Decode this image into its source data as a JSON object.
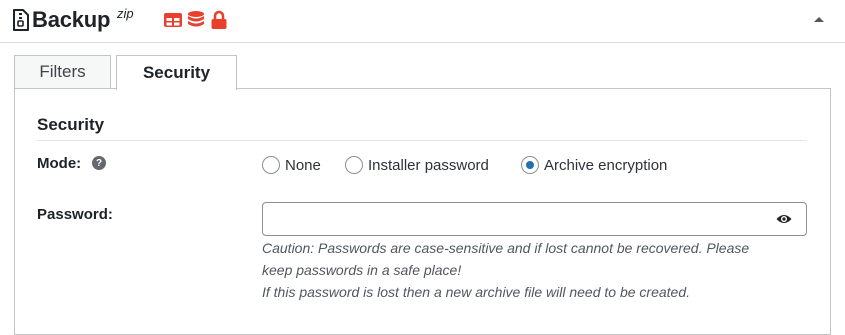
{
  "header": {
    "title": "Backup",
    "title_sup": "zip",
    "icons": [
      "file-zip-icon",
      "table-icon",
      "database-icon",
      "lock-icon",
      "collapse-arrow-icon"
    ],
    "accent_color": "#e8402d"
  },
  "tabs": [
    {
      "label": "Filters",
      "active": false
    },
    {
      "label": "Security",
      "active": true
    }
  ],
  "security": {
    "section_title": "Security",
    "mode": {
      "label": "Mode:",
      "help_icon": "question-icon",
      "options": [
        {
          "label": "None",
          "checked": false
        },
        {
          "label": "Installer password",
          "checked": false
        },
        {
          "label": "Archive encryption",
          "checked": true
        }
      ]
    },
    "password": {
      "label": "Password:",
      "value": "",
      "toggle_icon": "eye-icon",
      "caution_line1": "Caution: Passwords are case-sensitive and if lost cannot be recovered. Please",
      "caution_line2": "keep passwords in a safe place!",
      "caution_line3": "If this password is lost then a new archive file will need to be created."
    }
  },
  "colors": {
    "radio_checked": "#2271b1",
    "border": "#c3c4c7"
  }
}
